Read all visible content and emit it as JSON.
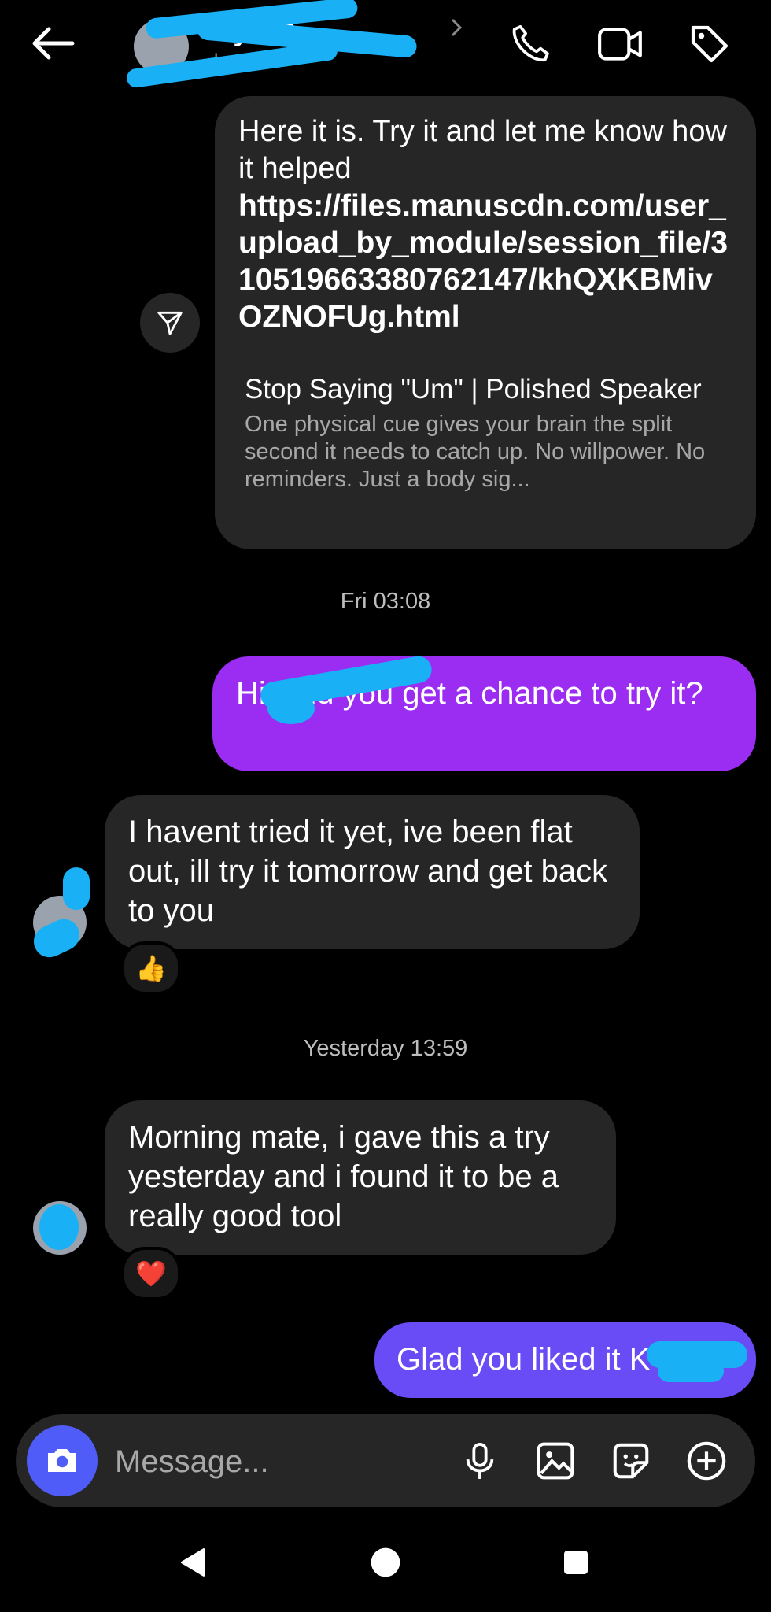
{
  "header": {
    "contact_name": "Kyle S",
    "contact_sub": "k"
  },
  "messages": {
    "m1_text": "Here it is. Try it and let me know how it helped",
    "m1_link": "https://files.manuscdn.com/user_upload_by_module/session_file/310519663380762147/khQXKBMivOZNOFUg.html",
    "m1_preview_title": "Stop Saying \"Um\" | Polished Speaker",
    "m1_preview_desc": "One physical cue gives your brain the split second it needs to catch up. No willpower. No reminders. Just a body sig...",
    "ts1": "Fri 03:08",
    "m2_text": "Hi , did you get a chance to try it?",
    "m3_text": "I havent tried it yet, ive been flat out, ill try it tomorrow and get back to you",
    "m3_reaction": "👍",
    "ts2": "Yesterday 13:59",
    "m4_text": "Morning mate, i gave this a try yesterday and i found it to be a really good tool",
    "m4_reaction": "❤️",
    "m5_text": "Glad you liked it K"
  },
  "composer": {
    "placeholder": "Message..."
  },
  "colors": {
    "background": "#000000",
    "incoming_bubble": "#262626",
    "outgoing_purple": "#9b2cf2",
    "outgoing_violet": "#6a4cf6",
    "camera_button": "#4f5cf7",
    "redaction": "#1ab0f5"
  }
}
